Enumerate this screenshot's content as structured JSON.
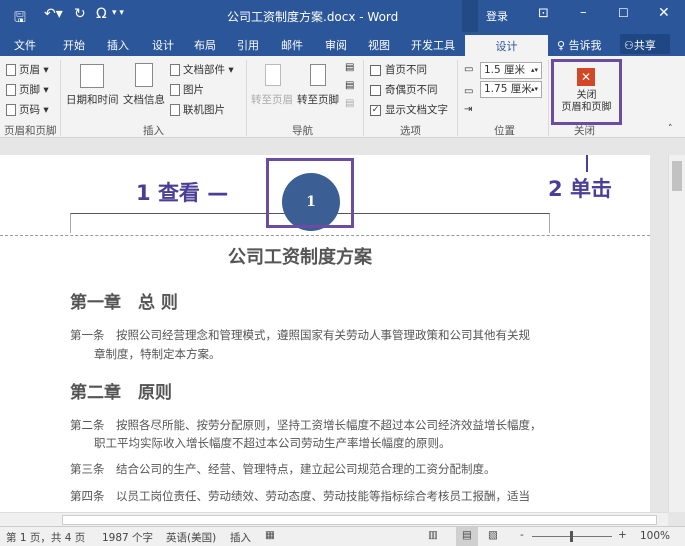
{
  "titlebar": {
    "title": "公司工资制度方案.docx - Word",
    "signin": "登录",
    "qat_omega": "Ω"
  },
  "tabs": [
    "文件",
    "开始",
    "插入",
    "设计",
    "布局",
    "引用",
    "邮件",
    "审阅",
    "视图",
    "开发工具"
  ],
  "active_tab": "设计",
  "tell_me": "告诉我",
  "share": "共享",
  "ribbon": {
    "header": "页眉",
    "footer": "页脚",
    "page_number": "页码",
    "group1": "页眉和页脚",
    "datetime": "日期和时间",
    "docinfo": "文档信息",
    "quickparts": "文档部件",
    "picture": "图片",
    "online_picture": "联机图片",
    "group2": "插入",
    "goto_header": "转至页眉",
    "goto_footer": "转至页脚",
    "group3": "导航",
    "diff_first": "首页不同",
    "diff_odd_even": "奇偶页不同",
    "show_text": "显示文档文字",
    "group4": "选项",
    "header_pos": "1.5 厘米",
    "footer_pos": "1.75 厘米",
    "group5": "位置",
    "close_line1": "关闭",
    "close_line2": "页眉和页脚",
    "group6": "关闭"
  },
  "annotations": {
    "view_num": "1",
    "view_text": "查看",
    "click_num": "2",
    "click_text": "单击"
  },
  "document": {
    "page_number": "1",
    "title": "公司工资制度方案",
    "ch1": "第一章　总 则",
    "a1_l1": "第一条　按照公司经营理念和管理模式，遵照国家有关劳动人事管理政策和公司其他有关规",
    "a1_l2": "章制度，特制定本方案。",
    "ch2": "第二章　原则",
    "a2_l1": "第二条　按照各尽所能、按劳分配原则，坚持工资增长幅度不超过本公司经济效益增长幅度，",
    "a2_l2": "职工平均实际收入增长幅度不超过本公司劳动生产率增长幅度的原则。",
    "a3": "第三条　结合公司的生产、经营、管理特点，建立起公司规范合理的工资分配制度。",
    "a4": "第四条　以员工岗位责任、劳动绩效、劳动态度、劳动技能等指标综合考核员工报酬，适当"
  },
  "status": {
    "page": "第 1 页，共 4 页",
    "words": "1987 个字",
    "lang": "英语(美国)",
    "mode": "插入",
    "zoom": "100%"
  }
}
